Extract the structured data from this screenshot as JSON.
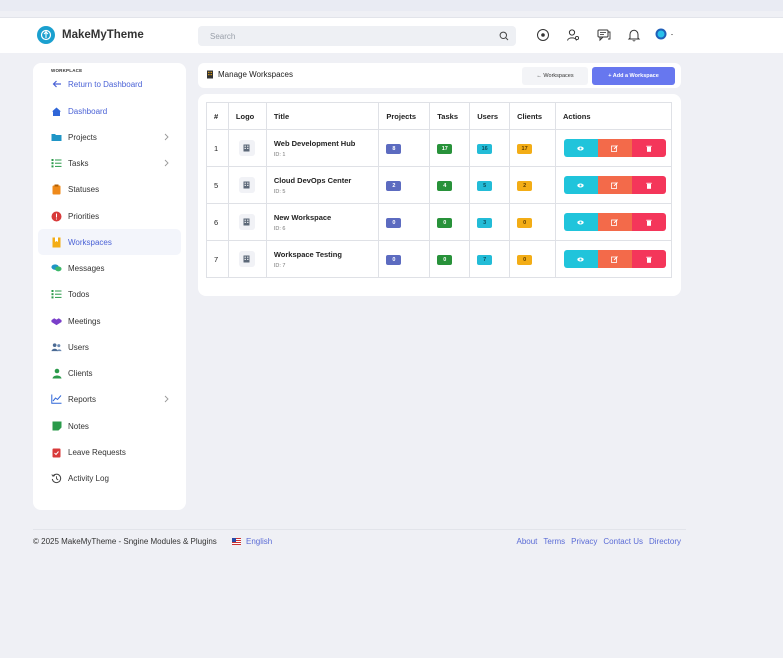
{
  "header": {
    "brand_name": "MakeMyTheme",
    "search_placeholder": "Search"
  },
  "sidebar": {
    "section_title": "WORKPLACE",
    "items": [
      {
        "label": "Return to Dashboard",
        "icon": "arrow-left-icon"
      },
      {
        "label": "Dashboard",
        "icon": "home-icon"
      },
      {
        "label": "Projects",
        "icon": "folder-icon",
        "has_children": true
      },
      {
        "label": "Tasks",
        "icon": "checklist-icon",
        "has_children": true
      },
      {
        "label": "Statuses",
        "icon": "clipboard-icon"
      },
      {
        "label": "Priorities",
        "icon": "alert-icon"
      },
      {
        "label": "Workspaces",
        "icon": "bookmark-icon",
        "active": true
      },
      {
        "label": "Messages",
        "icon": "chat-icon"
      },
      {
        "label": "Todos",
        "icon": "todo-icon"
      },
      {
        "label": "Meetings",
        "icon": "handshake-icon"
      },
      {
        "label": "Users",
        "icon": "users-icon"
      },
      {
        "label": "Clients",
        "icon": "client-icon"
      },
      {
        "label": "Reports",
        "icon": "chart-icon",
        "has_children": true
      },
      {
        "label": "Notes",
        "icon": "note-icon"
      },
      {
        "label": "Leave Requests",
        "icon": "leave-icon"
      },
      {
        "label": "Activity Log",
        "icon": "history-icon"
      }
    ]
  },
  "page": {
    "title": "Manage Workspaces",
    "workspaces_button": "← Workspaces",
    "add_button": "+ Add a Workspace"
  },
  "table": {
    "columns": [
      "#",
      "Logo",
      "Title",
      "Projects",
      "Tasks",
      "Users",
      "Clients",
      "Actions"
    ],
    "rows": [
      {
        "num": "1",
        "title": "Web Development Hub",
        "id": "ID: 1",
        "projects": "8",
        "tasks": "17",
        "users": "16",
        "clients": "17"
      },
      {
        "num": "5",
        "title": "Cloud DevOps Center",
        "id": "ID: 5",
        "projects": "2",
        "tasks": "4",
        "users": "5",
        "clients": "2"
      },
      {
        "num": "6",
        "title": "New Workspace",
        "id": "ID: 6",
        "projects": "0",
        "tasks": "0",
        "users": "3",
        "clients": "0"
      },
      {
        "num": "7",
        "title": "Workspace Testing",
        "id": "ID: 7",
        "projects": "0",
        "tasks": "0",
        "users": "7",
        "clients": "0"
      }
    ]
  },
  "footer": {
    "copyright": "© 2025 MakeMyTheme - Sngine Modules & Plugins",
    "language": "English",
    "links": [
      "About",
      "Terms",
      "Privacy",
      "Contact Us",
      "Directory"
    ]
  },
  "colors": {
    "accent": "#6777ef",
    "view": "#20c4db",
    "edit": "#f36a4a",
    "delete": "#f4365a"
  }
}
